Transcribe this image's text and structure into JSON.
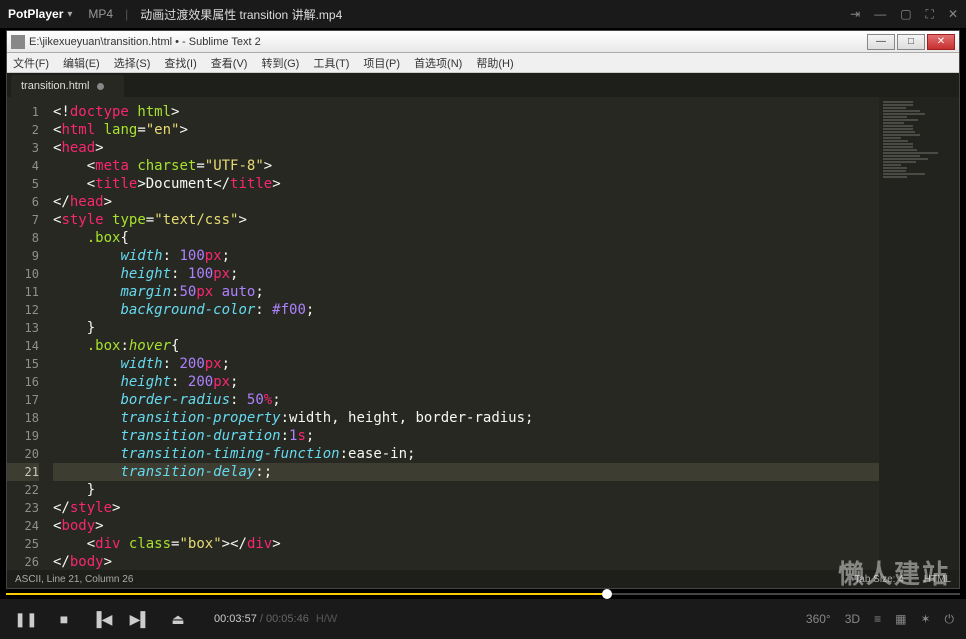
{
  "player": {
    "app_name": "PotPlayer",
    "format": "MP4",
    "filename": "动画过渡效果属性 transition 讲解.mp4",
    "current_time": "00:03:57",
    "duration": "00:05:46",
    "hw_label": "H/W",
    "right_icons": {
      "360": "360°",
      "3d": "3D",
      "list": "≡",
      "doc": "▦",
      "gear": "✶",
      "power": "⏻"
    }
  },
  "watermark": "懒人建站",
  "editor": {
    "title": "E:\\jikexueyuan\\transition.html • - Sublime Text 2",
    "menu": [
      "文件(F)",
      "编辑(E)",
      "选择(S)",
      "查找(I)",
      "查看(V)",
      "转到(G)",
      "工具(T)",
      "项目(P)",
      "首选项(N)",
      "帮助(H)"
    ],
    "tab": {
      "name": "transition.html",
      "dirty": true
    },
    "status": {
      "left": "ASCII, Line 21, Column 26",
      "tabsize": "Tab Size: 4",
      "lang": "HTML"
    },
    "code": [
      {
        "n": 1,
        "html": "<span class='c-brkt'>&lt;!</span><span class='c-doctype'>doctype</span> <span class='c-attr'>html</span><span class='c-brkt'>&gt;</span>"
      },
      {
        "n": 2,
        "html": "<span class='c-brkt'>&lt;</span><span class='c-tag'>html</span> <span class='c-attr'>lang</span><span class='c-punct'>=</span><span class='c-str'>\"en\"</span><span class='c-brkt'>&gt;</span>"
      },
      {
        "n": 3,
        "html": "<span class='c-brkt'>&lt;</span><span class='c-tag'>head</span><span class='c-brkt'>&gt;</span>"
      },
      {
        "n": 4,
        "html": "    <span class='c-brkt'>&lt;</span><span class='c-tag'>meta</span> <span class='c-attr'>charset</span><span class='c-punct'>=</span><span class='c-str'>\"UTF-8\"</span><span class='c-brkt'>&gt;</span>"
      },
      {
        "n": 5,
        "html": "    <span class='c-brkt'>&lt;</span><span class='c-tag'>title</span><span class='c-brkt'>&gt;</span><span class='c-text'>Document</span><span class='c-brkt'>&lt;/</span><span class='c-tag'>title</span><span class='c-brkt'>&gt;</span>"
      },
      {
        "n": 6,
        "html": "<span class='c-brkt'>&lt;/</span><span class='c-tag'>head</span><span class='c-brkt'>&gt;</span>"
      },
      {
        "n": 7,
        "html": "<span class='c-brkt'>&lt;</span><span class='c-tag'>style</span> <span class='c-attr'>type</span><span class='c-punct'>=</span><span class='c-str'>\"text/css\"</span><span class='c-brkt'>&gt;</span>"
      },
      {
        "n": 8,
        "html": "    <span class='c-sel'>.box</span><span class='c-punct'>{</span>"
      },
      {
        "n": 9,
        "html": "        <span class='c-prop'>width</span><span class='c-punct'>:</span> <span class='c-num'>100</span><span class='c-unit'>px</span><span class='c-punct'>;</span>"
      },
      {
        "n": 10,
        "html": "        <span class='c-prop'>height</span><span class='c-punct'>:</span> <span class='c-num'>100</span><span class='c-unit'>px</span><span class='c-punct'>;</span>"
      },
      {
        "n": 11,
        "html": "        <span class='c-prop'>margin</span><span class='c-punct'>:</span><span class='c-num'>50</span><span class='c-unit'>px</span> <span class='c-num'>auto</span><span class='c-punct'>;</span>"
      },
      {
        "n": 12,
        "html": "        <span class='c-prop'>background-color</span><span class='c-punct'>:</span> <span class='c-num'>#f00</span><span class='c-punct'>;</span>"
      },
      {
        "n": 13,
        "html": "    <span class='c-punct'>}</span>"
      },
      {
        "n": 14,
        "html": "    <span class='c-sel'>.box</span><span class='c-punct'>:</span><span class='c-pseudo'>hover</span><span class='c-punct'>{</span>"
      },
      {
        "n": 15,
        "html": "        <span class='c-prop'>width</span><span class='c-punct'>:</span> <span class='c-num'>200</span><span class='c-unit'>px</span><span class='c-punct'>;</span>"
      },
      {
        "n": 16,
        "html": "        <span class='c-prop'>height</span><span class='c-punct'>:</span> <span class='c-num'>200</span><span class='c-unit'>px</span><span class='c-punct'>;</span>"
      },
      {
        "n": 17,
        "html": "        <span class='c-prop'>border-radius</span><span class='c-punct'>:</span> <span class='c-num'>50</span><span class='c-unit'>%</span><span class='c-punct'>;</span>"
      },
      {
        "n": 18,
        "html": "        <span class='c-prop'>transition-property</span><span class='c-punct'>:</span><span class='c-text'>width, height, border-radius</span><span class='c-punct'>;</span>"
      },
      {
        "n": 19,
        "html": "        <span class='c-prop'>transition-duration</span><span class='c-punct'>:</span><span class='c-num'>1</span><span class='c-unit'>s</span><span class='c-punct'>;</span>"
      },
      {
        "n": 20,
        "html": "        <span class='c-prop'>transition-timing-function</span><span class='c-punct'>:</span><span class='c-text'>ease-in</span><span class='c-punct'>;</span>"
      },
      {
        "n": 21,
        "hl": true,
        "html": "        <span class='c-prop'>transition-delay</span><span class='c-punct'>:;</span>"
      },
      {
        "n": 22,
        "html": "    <span class='c-punct'>}</span>"
      },
      {
        "n": 23,
        "html": "<span class='c-brkt'>&lt;/</span><span class='c-tag'>style</span><span class='c-brkt'>&gt;</span>"
      },
      {
        "n": 24,
        "html": "<span class='c-brkt'>&lt;</span><span class='c-tag'>body</span><span class='c-brkt'>&gt;</span>"
      },
      {
        "n": 25,
        "html": "    <span class='c-brkt'>&lt;</span><span class='c-tag'>div</span> <span class='c-attr'>class</span><span class='c-punct'>=</span><span class='c-str'>\"box\"</span><span class='c-brkt'>&gt;&lt;/</span><span class='c-tag'>div</span><span class='c-brkt'>&gt;</span>"
      },
      {
        "n": 26,
        "html": "<span class='c-brkt'>&lt;/</span><span class='c-tag'>body</span><span class='c-brkt'>&gt;</span>"
      }
    ]
  }
}
